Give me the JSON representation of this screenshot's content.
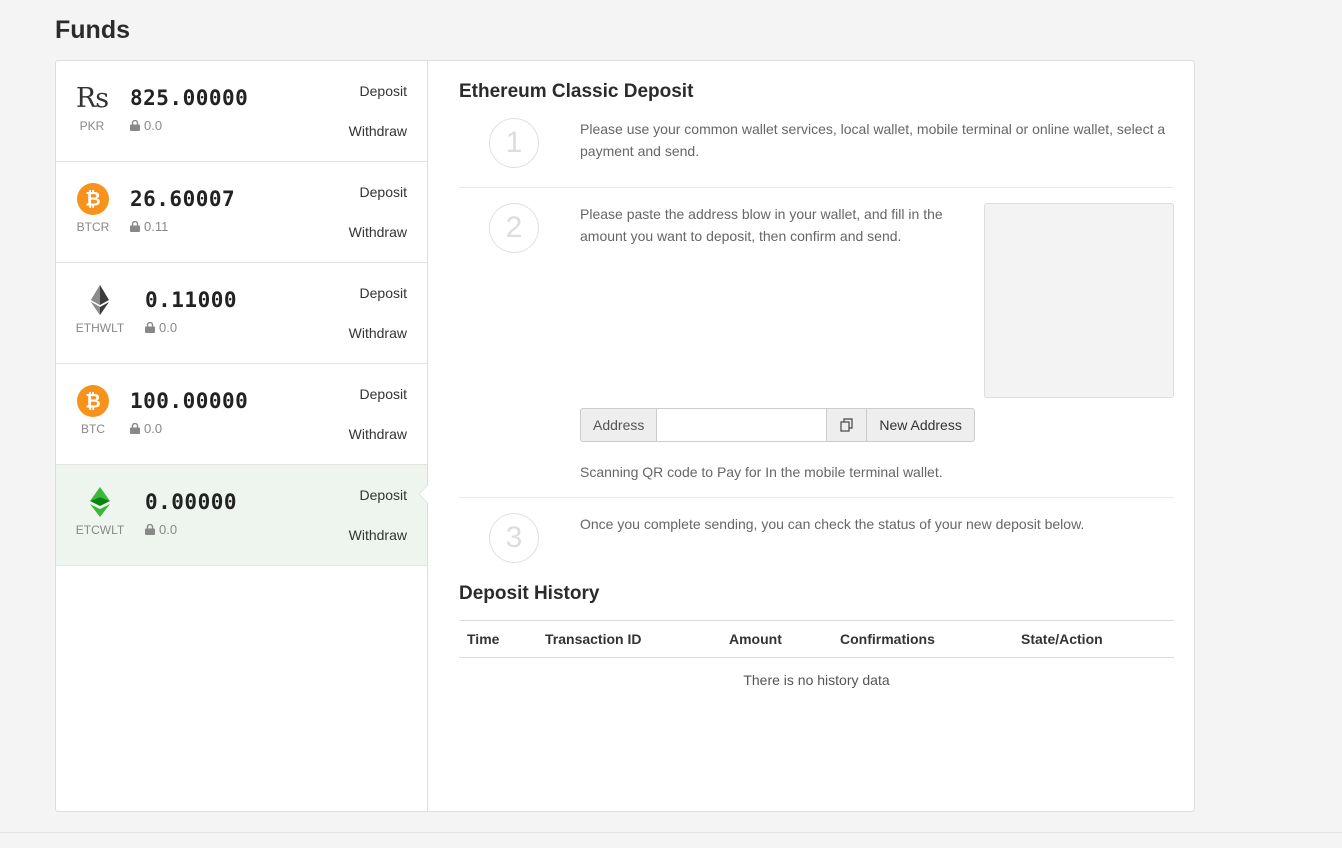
{
  "page": {
    "title": "Funds"
  },
  "assets": [
    {
      "icon": "rupee-icon",
      "code": "PKR",
      "amount": "825.00000",
      "locked": "0.0",
      "deposit": "Deposit",
      "withdraw": "Withdraw",
      "active": false
    },
    {
      "icon": "bitcoin-icon",
      "code": "BTCR",
      "amount": "26.60007",
      "locked": "0.11",
      "deposit": "Deposit",
      "withdraw": "Withdraw",
      "active": false
    },
    {
      "icon": "ethereum-icon",
      "code": "ETHWLT",
      "amount": "0.11000",
      "locked": "0.0",
      "deposit": "Deposit",
      "withdraw": "Withdraw",
      "active": false
    },
    {
      "icon": "bitcoin-icon",
      "code": "BTC",
      "amount": "100.00000",
      "locked": "0.0",
      "deposit": "Deposit",
      "withdraw": "Withdraw",
      "active": false
    },
    {
      "icon": "ethereum-classic-icon",
      "code": "ETCWLT",
      "amount": "0.00000",
      "locked": "0.0",
      "deposit": "Deposit",
      "withdraw": "Withdraw",
      "active": true
    }
  ],
  "deposit": {
    "title": "Ethereum Classic Deposit",
    "steps": [
      {
        "num": "1",
        "text": "Please use your common wallet services, local wallet, mobile terminal or online wallet, select a payment and send."
      },
      {
        "num": "2",
        "text": "Please paste the address blow in your wallet, and fill in the amount you want to deposit, then confirm and send."
      },
      {
        "num": "3",
        "text": "Once you complete sending, you can check the status of your new deposit below."
      }
    ],
    "address_label": "Address",
    "address_value": "",
    "new_address": "New Address",
    "qr_note": "Scanning QR code to Pay for In the mobile terminal wallet."
  },
  "history": {
    "title": "Deposit History",
    "columns": [
      "Time",
      "Transaction ID",
      "Amount",
      "Confirmations",
      "State/Action"
    ],
    "empty": "There is no history data"
  },
  "colors": {
    "bitcoin": "#f7931a",
    "etc_green": "#3ab83a",
    "active_row": "#eef5ef"
  }
}
